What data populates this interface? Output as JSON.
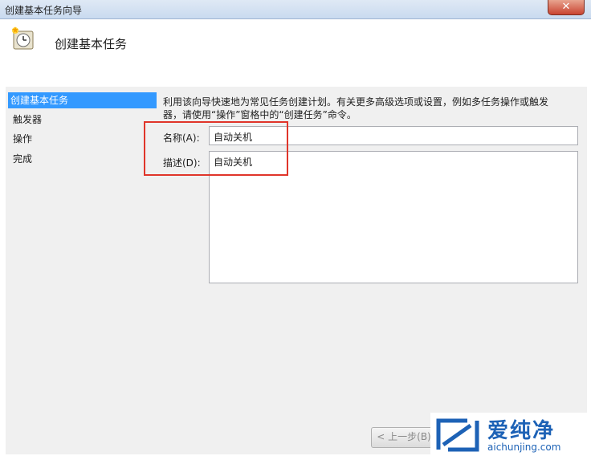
{
  "window": {
    "title": "创建基本任务向导",
    "close_label": "✕"
  },
  "header": {
    "title": "创建基本任务",
    "icon": "clock-icon"
  },
  "nav": {
    "items": [
      {
        "label": "创建基本任务",
        "active": true
      },
      {
        "label": "触发器",
        "active": false
      },
      {
        "label": "操作",
        "active": false
      },
      {
        "label": "完成",
        "active": false
      }
    ]
  },
  "main": {
    "description_line1": "利用该向导快速地为常见任务创建计划。有关更多高级选项或设置，例如多任务操作或触发",
    "description_line2": "器，请使用“操作”窗格中的“创建任务”命令。",
    "name_label": "名称(A):",
    "name_value": "自动关机",
    "desc_label": "描述(D):",
    "desc_value": "自动关机"
  },
  "buttons": {
    "back": "< 上一步(B)"
  },
  "watermark": {
    "brand": "爱纯净",
    "url": "aichunjing.com"
  },
  "colors": {
    "accent": "#3399ff",
    "highlight_box": "#e0352a",
    "brand": "#1d62b6"
  }
}
